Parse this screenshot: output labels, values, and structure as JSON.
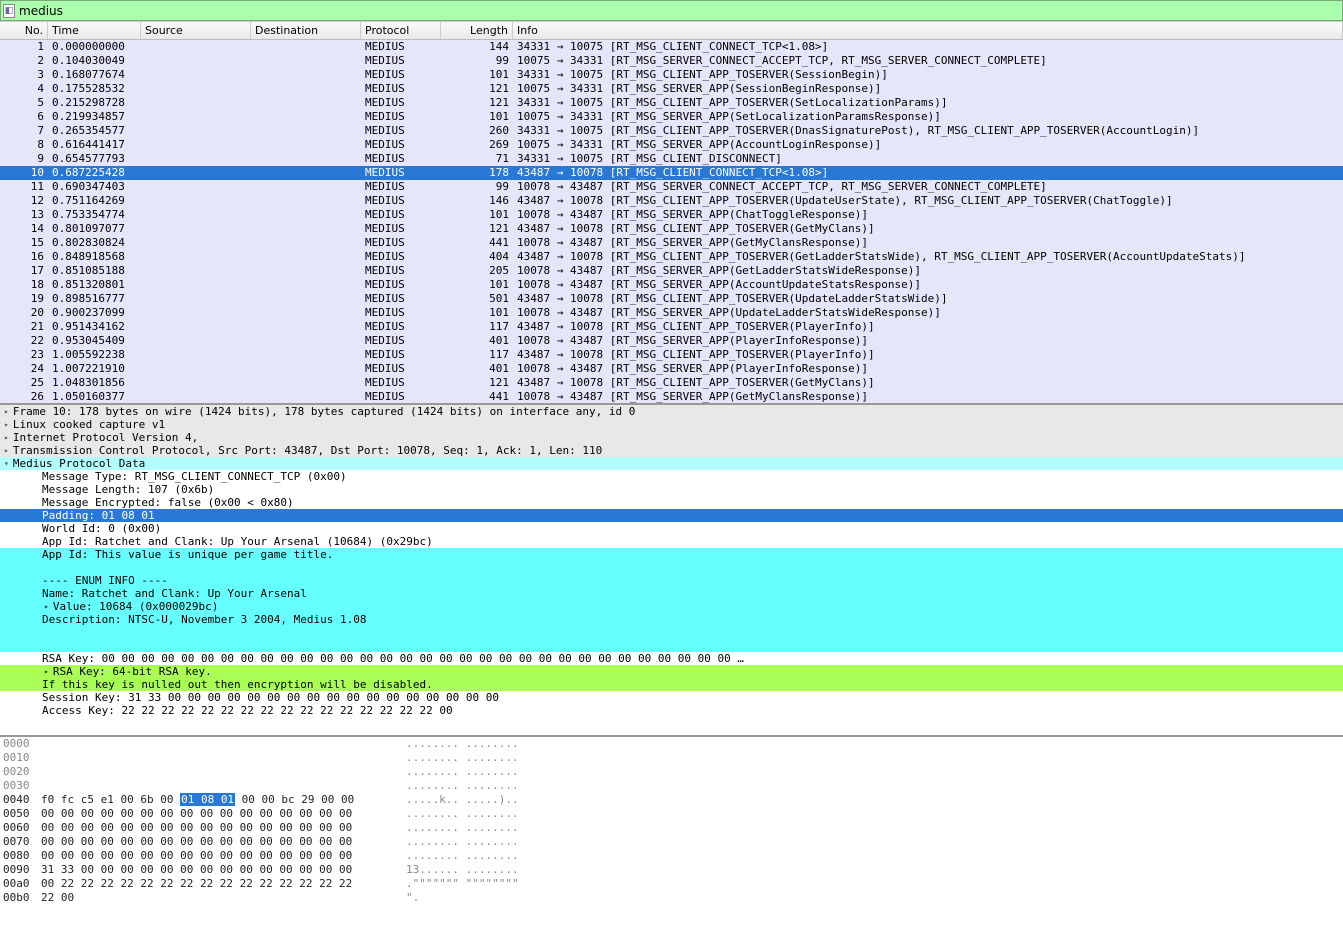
{
  "filter": {
    "value": "medius"
  },
  "columns": [
    "No.",
    "Time",
    "Source",
    "Destination",
    "Protocol",
    "Length",
    "Info"
  ],
  "selected_index": 9,
  "packets": [
    {
      "no": "1",
      "time": "0.000000000",
      "src": "",
      "dst": "",
      "proto": "MEDIUS",
      "len": "144",
      "info": "34331 → 10075 [RT_MSG_CLIENT_CONNECT_TCP<1.08>]"
    },
    {
      "no": "2",
      "time": "0.104030049",
      "src": "",
      "dst": "",
      "proto": "MEDIUS",
      "len": "99",
      "info": "10075 → 34331 [RT_MSG_SERVER_CONNECT_ACCEPT_TCP, RT_MSG_SERVER_CONNECT_COMPLETE]"
    },
    {
      "no": "3",
      "time": "0.168077674",
      "src": "",
      "dst": "",
      "proto": "MEDIUS",
      "len": "101",
      "info": "34331 → 10075 [RT_MSG_CLIENT_APP_TOSERVER(SessionBegin)]"
    },
    {
      "no": "4",
      "time": "0.175528532",
      "src": "",
      "dst": "",
      "proto": "MEDIUS",
      "len": "121",
      "info": "10075 → 34331 [RT_MSG_SERVER_APP(SessionBeginResponse)]"
    },
    {
      "no": "5",
      "time": "0.215298728",
      "src": "",
      "dst": "",
      "proto": "MEDIUS",
      "len": "121",
      "info": "34331 → 10075 [RT_MSG_CLIENT_APP_TOSERVER(SetLocalizationParams)]"
    },
    {
      "no": "6",
      "time": "0.219934857",
      "src": "",
      "dst": "",
      "proto": "MEDIUS",
      "len": "101",
      "info": "10075 → 34331 [RT_MSG_SERVER_APP(SetLocalizationParamsResponse)]"
    },
    {
      "no": "7",
      "time": "0.265354577",
      "src": "",
      "dst": "",
      "proto": "MEDIUS",
      "len": "260",
      "info": "34331 → 10075 [RT_MSG_CLIENT_APP_TOSERVER(DnasSignaturePost), RT_MSG_CLIENT_APP_TOSERVER(AccountLogin)]"
    },
    {
      "no": "8",
      "time": "0.616441417",
      "src": "",
      "dst": "",
      "proto": "MEDIUS",
      "len": "269",
      "info": "10075 → 34331 [RT_MSG_SERVER_APP(AccountLoginResponse)]"
    },
    {
      "no": "9",
      "time": "0.654577793",
      "src": "",
      "dst": "",
      "proto": "MEDIUS",
      "len": "71",
      "info": "34331 → 10075 [RT_MSG_CLIENT_DISCONNECT]"
    },
    {
      "no": "10",
      "time": "0.687225428",
      "src": "",
      "dst": "",
      "proto": "MEDIUS",
      "len": "178",
      "info": "43487 → 10078 [RT_MSG_CLIENT_CONNECT_TCP<1.08>]"
    },
    {
      "no": "11",
      "time": "0.690347403",
      "src": "",
      "dst": "",
      "proto": "MEDIUS",
      "len": "99",
      "info": "10078 → 43487 [RT_MSG_SERVER_CONNECT_ACCEPT_TCP, RT_MSG_SERVER_CONNECT_COMPLETE]"
    },
    {
      "no": "12",
      "time": "0.751164269",
      "src": "",
      "dst": "",
      "proto": "MEDIUS",
      "len": "146",
      "info": "43487 → 10078 [RT_MSG_CLIENT_APP_TOSERVER(UpdateUserState), RT_MSG_CLIENT_APP_TOSERVER(ChatToggle)]"
    },
    {
      "no": "13",
      "time": "0.753354774",
      "src": "",
      "dst": "",
      "proto": "MEDIUS",
      "len": "101",
      "info": "10078 → 43487 [RT_MSG_SERVER_APP(ChatToggleResponse)]"
    },
    {
      "no": "14",
      "time": "0.801097077",
      "src": "",
      "dst": "",
      "proto": "MEDIUS",
      "len": "121",
      "info": "43487 → 10078 [RT_MSG_CLIENT_APP_TOSERVER(GetMyClans)]"
    },
    {
      "no": "15",
      "time": "0.802830824",
      "src": "",
      "dst": "",
      "proto": "MEDIUS",
      "len": "441",
      "info": "10078 → 43487 [RT_MSG_SERVER_APP(GetMyClansResponse)]"
    },
    {
      "no": "16",
      "time": "0.848918568",
      "src": "",
      "dst": "",
      "proto": "MEDIUS",
      "len": "404",
      "info": "43487 → 10078 [RT_MSG_CLIENT_APP_TOSERVER(GetLadderStatsWide), RT_MSG_CLIENT_APP_TOSERVER(AccountUpdateStats)]"
    },
    {
      "no": "17",
      "time": "0.851085188",
      "src": "",
      "dst": "",
      "proto": "MEDIUS",
      "len": "205",
      "info": "10078 → 43487 [RT_MSG_SERVER_APP(GetLadderStatsWideResponse)]"
    },
    {
      "no": "18",
      "time": "0.851320801",
      "src": "",
      "dst": "",
      "proto": "MEDIUS",
      "len": "101",
      "info": "10078 → 43487 [RT_MSG_SERVER_APP(AccountUpdateStatsResponse)]"
    },
    {
      "no": "19",
      "time": "0.898516777",
      "src": "",
      "dst": "",
      "proto": "MEDIUS",
      "len": "501",
      "info": "43487 → 10078 [RT_MSG_CLIENT_APP_TOSERVER(UpdateLadderStatsWide)]"
    },
    {
      "no": "20",
      "time": "0.900237099",
      "src": "",
      "dst": "",
      "proto": "MEDIUS",
      "len": "101",
      "info": "10078 → 43487 [RT_MSG_SERVER_APP(UpdateLadderStatsWideResponse)]"
    },
    {
      "no": "21",
      "time": "0.951434162",
      "src": "",
      "dst": "",
      "proto": "MEDIUS",
      "len": "117",
      "info": "43487 → 10078 [RT_MSG_CLIENT_APP_TOSERVER(PlayerInfo)]"
    },
    {
      "no": "22",
      "time": "0.953045409",
      "src": "",
      "dst": "",
      "proto": "MEDIUS",
      "len": "401",
      "info": "10078 → 43487 [RT_MSG_SERVER_APP(PlayerInfoResponse)]"
    },
    {
      "no": "23",
      "time": "1.005592238",
      "src": "",
      "dst": "",
      "proto": "MEDIUS",
      "len": "117",
      "info": "43487 → 10078 [RT_MSG_CLIENT_APP_TOSERVER(PlayerInfo)]"
    },
    {
      "no": "24",
      "time": "1.007221910",
      "src": "",
      "dst": "",
      "proto": "MEDIUS",
      "len": "401",
      "info": "10078 → 43487 [RT_MSG_SERVER_APP(PlayerInfoResponse)]"
    },
    {
      "no": "25",
      "time": "1.048301856",
      "src": "",
      "dst": "",
      "proto": "MEDIUS",
      "len": "121",
      "info": "43487 → 10078 [RT_MSG_CLIENT_APP_TOSERVER(GetMyClans)]"
    },
    {
      "no": "26",
      "time": "1.050160377",
      "src": "",
      "dst": "",
      "proto": "MEDIUS",
      "len": "441",
      "info": "10078 → 43487 [RT_MSG_SERVER_APP(GetMyClansResponse)]"
    }
  ],
  "details": [
    {
      "cls": "dl e hl-head",
      "t": "Frame 10: 178 bytes on wire (1424 bits), 178 bytes captured (1424 bits) on interface any, id 0"
    },
    {
      "cls": "dl e hl-head",
      "t": "Linux cooked capture v1"
    },
    {
      "cls": "dl e hl-head",
      "t": "Internet Protocol Version 4,"
    },
    {
      "cls": "dl e hl-head",
      "t": "Transmission Control Protocol, Src Port: 43487, Dst Port: 10078, Seq: 1, Ack: 1, Len: 110"
    },
    {
      "cls": "dl o hl-cyan-head",
      "t": "Medius Protocol Data"
    },
    {
      "cls": "dl ne i1",
      "t": "Message Type: RT_MSG_CLIENT_CONNECT_TCP (0x00)"
    },
    {
      "cls": "dl ne i1",
      "t": "Message Length: 107 (0x6b)"
    },
    {
      "cls": "dl ne i1",
      "t": "Message Encrypted: false (0x00 < 0x80)"
    },
    {
      "cls": "dl ne i1 hl-blue",
      "t": "Padding: 01 08 01"
    },
    {
      "cls": "dl ne i1",
      "t": "World Id: 0 (0x00)"
    },
    {
      "cls": "dl ne i1",
      "t": "App Id: Ratchet and Clank: Up Your Arsenal (10684) (0x29bc)"
    },
    {
      "cls": "dl ne i1 hl-cyan",
      "t": "App Id: This value is unique per game title."
    },
    {
      "cls": "dl ne i1 hl-cyan",
      "t": ""
    },
    {
      "cls": "dl ne i1 hl-cyan",
      "t": "---- ENUM INFO ----"
    },
    {
      "cls": "dl ne i1 hl-cyan",
      "t": "Name: Ratchet and Clank: Up Your Arsenal"
    },
    {
      "cls": "dl ne i1 hl-cyan",
      "t": "Value: 10684 (0x000029bc)",
      "exp": true
    },
    {
      "cls": "dl ne i1 hl-cyan",
      "t": "Description: NTSC-U, November 3 2004, Medius 1.08"
    },
    {
      "cls": "dl ne i1 hl-cyan",
      "t": ""
    },
    {
      "cls": "dl ne i1 hl-cyan",
      "t": ""
    },
    {
      "cls": "dl ne i1",
      "t": "RSA Key: 00 00 00 00 00 00 00 00 00 00 00 00 00 00 00 00 00 00 00 00 00 00 00 00 00 00 00 00 00 00 00 00 …"
    },
    {
      "cls": "dl ne i1 hl-green",
      "t": "RSA Key: 64-bit RSA key.",
      "exp": true
    },
    {
      "cls": "dl ne i1 hl-green",
      "t": "If this key is nulled out then encryption will be disabled."
    },
    {
      "cls": "dl ne i1",
      "t": "Session Key: 31 33 00 00 00 00 00 00 00 00 00 00 00 00 00 00 00 00 00"
    },
    {
      "cls": "dl ne i1",
      "t": "Access Key: 22 22 22 22 22 22 22 22 22 22 22 22 22 22 22 22 00"
    }
  ],
  "hex": [
    {
      "off": "0000",
      "h": "",
      "a": "........ ........"
    },
    {
      "off": "0010",
      "h": "",
      "a": "........ ........"
    },
    {
      "off": "0020",
      "h": "",
      "a": "........ ........"
    },
    {
      "off": "0030",
      "h": "",
      "a": "........ ........"
    },
    {
      "off": "0040",
      "h": "f0 fc c5 e1 00 6b 00 |01 08 01| 00 00 bc 29 00 00",
      "a": ".....k.. .....)..",
      "active": true
    },
    {
      "off": "0050",
      "h": "00 00 00 00 00 00 00 00  00 00 00 00 00 00 00 00",
      "a": "........ ........",
      "active": true
    },
    {
      "off": "0060",
      "h": "00 00 00 00 00 00 00 00  00 00 00 00 00 00 00 00",
      "a": "........ ........",
      "active": true
    },
    {
      "off": "0070",
      "h": "00 00 00 00 00 00 00 00  00 00 00 00 00 00 00 00",
      "a": "........ ........",
      "active": true
    },
    {
      "off": "0080",
      "h": "00 00 00 00 00 00 00 00  00 00 00 00 00 00 00 00",
      "a": "........ ........",
      "active": true
    },
    {
      "off": "0090",
      "h": "31 33 00 00 00 00 00 00  00 00 00 00 00 00 00 00",
      "a": "13...... ........",
      "active": true
    },
    {
      "off": "00a0",
      "h": "00 22 22 22 22 22 22 22  22 22 22 22 22 22 22 22",
      "a": ".\"\"\"\"\"\"\" \"\"\"\"\"\"\"\"",
      "active": true
    },
    {
      "off": "00b0",
      "h": "22 00",
      "a": "\".",
      "active": true
    }
  ]
}
